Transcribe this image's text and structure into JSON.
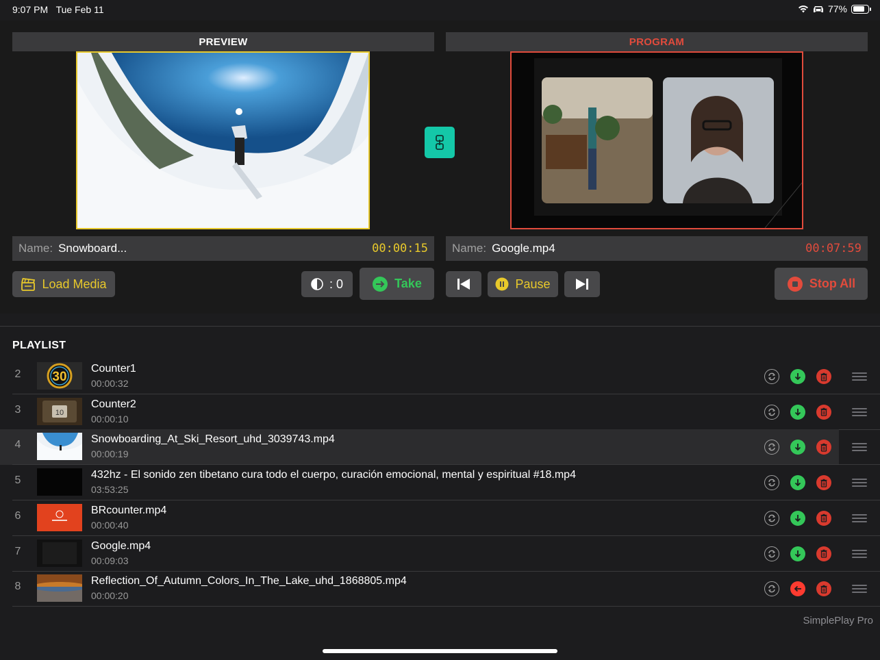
{
  "status": {
    "time": "9:07 PM",
    "date": "Tue Feb 11",
    "battery": "77%",
    "battery_level": 0.77
  },
  "preview": {
    "header": "PREVIEW",
    "name_label": "Name:",
    "name": "Snowboard...",
    "timecode": "00:00:15",
    "border_color": "#e8c92b"
  },
  "program": {
    "header": "PROGRAM",
    "name_label": "Name:",
    "name": "Google.mp4",
    "timecode": "00:07:59",
    "border_color": "#e24b3c"
  },
  "controls": {
    "load_media": "Load Media",
    "transition_value": ": 0",
    "take": "Take",
    "pause": "Pause",
    "stop_all": "Stop All",
    "swap_icon": "link-swap-icon"
  },
  "playlist": {
    "title": "PLAYLIST",
    "items": [
      {
        "num": "2",
        "title": "Counter1",
        "duration": "00:00:32",
        "thumb": "counter30",
        "cue": "down"
      },
      {
        "num": "3",
        "title": "Counter2",
        "duration": "00:00:10",
        "thumb": "counter10",
        "cue": "down"
      },
      {
        "num": "4",
        "title": "Snowboarding_At_Ski_Resort_uhd_3039743.mp4",
        "duration": "00:00:19",
        "thumb": "snow",
        "cue": "down",
        "selected": true
      },
      {
        "num": "5",
        "title": "432hz - El sonido zen tibetano cura todo el cuerpo, curación emocional, mental y espiritual #18.mp4",
        "duration": "03:53:25",
        "thumb": "black",
        "cue": "down"
      },
      {
        "num": "6",
        "title": "BRcounter.mp4",
        "duration": "00:00:40",
        "thumb": "orange",
        "cue": "down"
      },
      {
        "num": "7",
        "title": "Google.mp4",
        "duration": "00:09:03",
        "thumb": "dark",
        "cue": "down"
      },
      {
        "num": "8",
        "title": "Reflection_Of_Autumn_Colors_In_The_Lake_uhd_1868805.mp4",
        "duration": "00:00:20",
        "thumb": "autumn",
        "cue": "back"
      }
    ]
  },
  "brand": "SimplePlay Pro",
  "colors": {
    "accent_yellow": "#e8c92b",
    "take_green": "#34c759",
    "program_red": "#e24b3c",
    "swap_teal": "#14c8a8"
  }
}
